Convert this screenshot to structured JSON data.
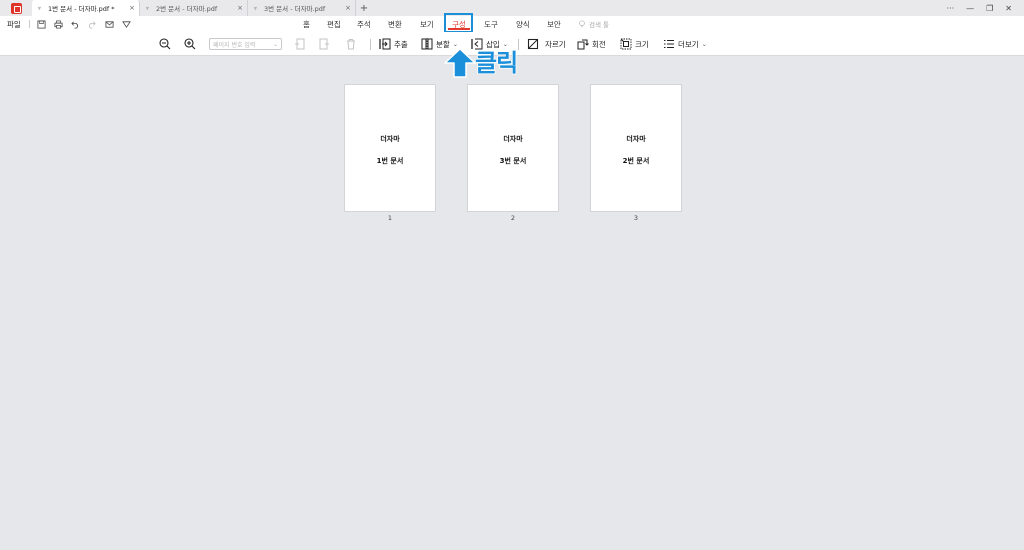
{
  "tabs": [
    {
      "label": "1번 문서 - 더자마.pdf *",
      "active": true
    },
    {
      "label": "2번 문서 - 더자마.pdf",
      "active": false
    },
    {
      "label": "3번 문서 - 더자마.pdf",
      "active": false
    }
  ],
  "tab_close": "×",
  "tab_new": "+",
  "window_controls": {
    "more": "···",
    "minimize": "—",
    "restore": "❐",
    "close": "✕"
  },
  "file_menu": "파일",
  "menu": [
    "홈",
    "편집",
    "주석",
    "변환",
    "보기",
    "구성",
    "도구",
    "양식",
    "보안"
  ],
  "active_menu": "구성",
  "smart_search": "검색 툴",
  "toolbar": {
    "page_input_placeholder": "페이지 번호 입력",
    "extract": "추출",
    "split": "분할",
    "insert": "삽입",
    "crop": "자르기",
    "rotate": "회전",
    "resize": "크기",
    "more": "더보기",
    "caret": "⌄"
  },
  "annotation": "클릭",
  "pages": [
    {
      "title": "더자마",
      "doc": "1번 문서",
      "number": "1"
    },
    {
      "title": "더자마",
      "doc": "3번 문서",
      "number": "2"
    },
    {
      "title": "더자마",
      "doc": "2번 문서",
      "number": "3"
    }
  ],
  "colors": {
    "accent": "#e03a2e",
    "annotation_blue": "#1b8fd9",
    "background": "#e6e7eb"
  }
}
